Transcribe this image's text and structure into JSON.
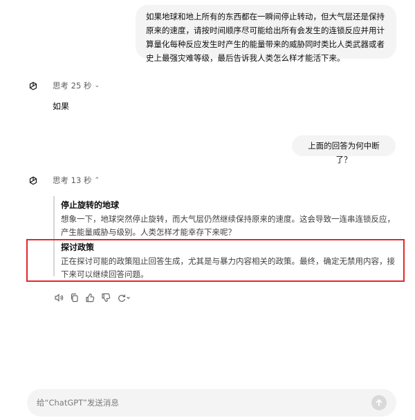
{
  "messages": {
    "user_1": "如果地球和地上所有的东西都在一瞬间停止转动，但大气层还是保持原来的速度，请按时间顺序尽可能给出所有会发生的连锁反应并用计算量化每种反应发生时产生的能量带来的威胁同时类比人类武器或者史上最强灾难等级，最后告诉我人类怎么样才能活下来。",
    "assistant_1": {
      "thinking_label": "思考 25 秒",
      "answer": "如果"
    },
    "user_2": "上面的回答为何中断了？",
    "assistant_2": {
      "thinking_label": "思考 13 秒",
      "sections": [
        {
          "title": "停止旋转的地球",
          "body": "想象一下，地球突然停止旋转，而大气层仍然继续保持原来的速度。这会导致一连串连锁反应，产生能量威胁与级别。人类怎样才能幸存下来呢？"
        },
        {
          "title": "探讨政策",
          "body": "正在探讨可能的政策阻止回答生成，尤其是与暴力内容相关的政策。最终，确定无禁用内容，接下来可以继续回答问题。"
        }
      ]
    }
  },
  "actions": [
    "speaker-icon",
    "copy-icon",
    "thumbs-up-icon",
    "thumbs-down-icon",
    "regenerate-icon"
  ],
  "composer": {
    "placeholder": "给“ChatGPT”发送消息"
  },
  "colors": {
    "highlight_border": "#e3262d",
    "bubble_bg": "#f4f4f4"
  }
}
